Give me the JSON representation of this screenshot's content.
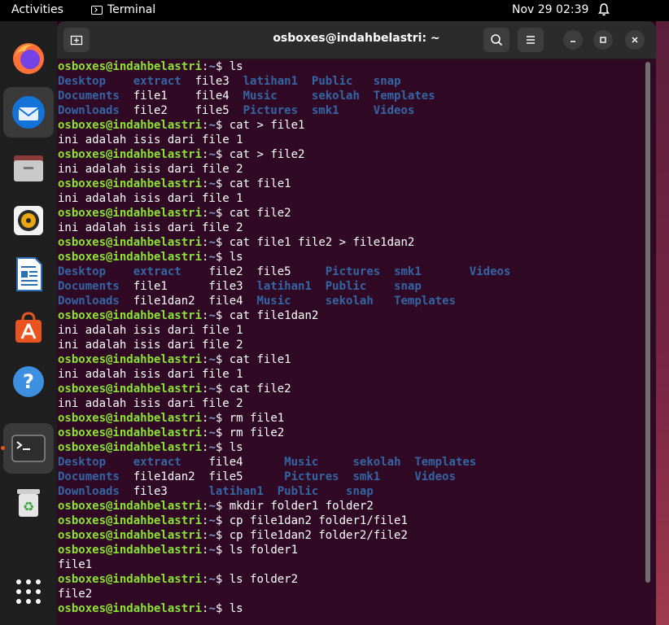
{
  "topbar": {
    "activities": "Activities",
    "app_name": "Terminal",
    "clock": "Nov 29  02:39",
    "bell_icon": "bell-icon"
  },
  "dock": {
    "items": [
      {
        "name": "Firefox",
        "icon": "firefox-icon"
      },
      {
        "name": "Thunderbird",
        "icon": "thunderbird-icon"
      },
      {
        "name": "Files",
        "icon": "files-icon"
      },
      {
        "name": "Rhythmbox",
        "icon": "rhythmbox-icon"
      },
      {
        "name": "LibreOffice Writer",
        "icon": "writer-icon"
      },
      {
        "name": "Ubuntu Software",
        "icon": "software-icon"
      },
      {
        "name": "Help",
        "icon": "help-icon"
      },
      {
        "name": "Terminal",
        "icon": "terminal-icon"
      },
      {
        "name": "Trash",
        "icon": "trash-icon"
      },
      {
        "name": "Show Applications",
        "icon": "app-grid-icon"
      }
    ]
  },
  "window": {
    "title": "osboxes@indahbelastri: ~"
  },
  "colors": {
    "prompt": "#8ae234",
    "path": "#729fcf",
    "directory": "#3465a4",
    "text": "#ffffff",
    "background": "#300a24"
  },
  "terminal": {
    "user_host": "osboxes@indahbelastri",
    "sep": ":",
    "path": "~",
    "dollar": "$ ",
    "lines": [
      {
        "t": "cmd",
        "v": "ls"
      },
      {
        "t": "ls",
        "v": [
          [
            "Desktop",
            1
          ],
          [
            "    ",
            0
          ],
          [
            "extract",
            1
          ],
          [
            "  file3  ",
            0
          ],
          [
            "latihan1",
            1
          ],
          [
            "  ",
            0
          ],
          [
            "Public",
            1
          ],
          [
            "   ",
            0
          ],
          [
            "snap",
            1
          ]
        ]
      },
      {
        "t": "ls",
        "v": [
          [
            "Documents",
            1
          ],
          [
            "  file1    file4  ",
            0
          ],
          [
            "Music",
            1
          ],
          [
            "     ",
            0
          ],
          [
            "sekolah",
            1
          ],
          [
            "  ",
            0
          ],
          [
            "Templates",
            1
          ]
        ]
      },
      {
        "t": "ls",
        "v": [
          [
            "Downloads",
            1
          ],
          [
            "  file2    file5  ",
            0
          ],
          [
            "Pictures",
            1
          ],
          [
            "  ",
            0
          ],
          [
            "smk1",
            1
          ],
          [
            "     ",
            0
          ],
          [
            "Videos",
            1
          ]
        ]
      },
      {
        "t": "cmd",
        "v": "cat > file1"
      },
      {
        "t": "out",
        "v": "ini adalah isis dari file 1"
      },
      {
        "t": "cmd",
        "v": "cat > file2"
      },
      {
        "t": "out",
        "v": "ini adalah isis dari file 2"
      },
      {
        "t": "cmd",
        "v": "cat file1"
      },
      {
        "t": "out",
        "v": "ini adalah isis dari file 1"
      },
      {
        "t": "cmd",
        "v": "cat file2"
      },
      {
        "t": "out",
        "v": "ini adalah isis dari file 2"
      },
      {
        "t": "cmd",
        "v": "cat file1 file2 > file1dan2"
      },
      {
        "t": "cmd",
        "v": "ls"
      },
      {
        "t": "ls",
        "v": [
          [
            "Desktop",
            1
          ],
          [
            "    ",
            0
          ],
          [
            "extract",
            1
          ],
          [
            "    file2  file5     ",
            0
          ],
          [
            "Pictures",
            1
          ],
          [
            "  ",
            0
          ],
          [
            "smk1",
            1
          ],
          [
            "       ",
            0
          ],
          [
            "Videos",
            1
          ]
        ]
      },
      {
        "t": "ls",
        "v": [
          [
            "Documents",
            1
          ],
          [
            "  file1      file3  ",
            0
          ],
          [
            "latihan1",
            1
          ],
          [
            "  ",
            0
          ],
          [
            "Public",
            1
          ],
          [
            "    ",
            0
          ],
          [
            "snap",
            1
          ]
        ]
      },
      {
        "t": "ls",
        "v": [
          [
            "Downloads",
            1
          ],
          [
            "  file1dan2  file4  ",
            0
          ],
          [
            "Music",
            1
          ],
          [
            "     ",
            0
          ],
          [
            "sekolah",
            1
          ],
          [
            "   ",
            0
          ],
          [
            "Templates",
            1
          ]
        ]
      },
      {
        "t": "cmd",
        "v": "cat file1dan2"
      },
      {
        "t": "out",
        "v": "ini adalah isis dari file 1"
      },
      {
        "t": "out",
        "v": "ini adalah isis dari file 2"
      },
      {
        "t": "cmd",
        "v": "cat file1"
      },
      {
        "t": "out",
        "v": "ini adalah isis dari file 1"
      },
      {
        "t": "cmd",
        "v": "cat file2"
      },
      {
        "t": "out",
        "v": "ini adalah isis dari file 2"
      },
      {
        "t": "cmd",
        "v": "rm file1"
      },
      {
        "t": "cmd",
        "v": "rm file2"
      },
      {
        "t": "cmd",
        "v": "ls"
      },
      {
        "t": "ls",
        "v": [
          [
            "Desktop",
            1
          ],
          [
            "    ",
            0
          ],
          [
            "extract",
            1
          ],
          [
            "    file4      ",
            0
          ],
          [
            "Music",
            1
          ],
          [
            "     ",
            0
          ],
          [
            "sekolah",
            1
          ],
          [
            "  ",
            0
          ],
          [
            "Templates",
            1
          ]
        ]
      },
      {
        "t": "ls",
        "v": [
          [
            "Documents",
            1
          ],
          [
            "  file1dan2  file5      ",
            0
          ],
          [
            "Pictures",
            1
          ],
          [
            "  ",
            0
          ],
          [
            "smk1",
            1
          ],
          [
            "     ",
            0
          ],
          [
            "Videos",
            1
          ]
        ]
      },
      {
        "t": "ls",
        "v": [
          [
            "Downloads",
            1
          ],
          [
            "  file3      ",
            0
          ],
          [
            "latihan1",
            1
          ],
          [
            "  ",
            0
          ],
          [
            "Public",
            1
          ],
          [
            "    ",
            0
          ],
          [
            "snap",
            1
          ]
        ]
      },
      {
        "t": "cmd",
        "v": "mkdir folder1 folder2"
      },
      {
        "t": "cmd",
        "v": "cp file1dan2 folder1/file1"
      },
      {
        "t": "cmd",
        "v": "cp file1dan2 folder2/file2"
      },
      {
        "t": "cmd",
        "v": "ls folder1"
      },
      {
        "t": "out",
        "v": "file1"
      },
      {
        "t": "cmd",
        "v": "ls folder2"
      },
      {
        "t": "out",
        "v": "file2"
      },
      {
        "t": "cmd",
        "v": "ls"
      }
    ]
  }
}
